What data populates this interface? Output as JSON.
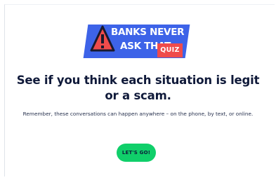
{
  "logo": {
    "line1": "BANKS NEVER",
    "line2": "ASK THAT",
    "tag": "QUIZ",
    "icon": "warning-triangle-icon",
    "colors": {
      "banner": "#3d63e8",
      "triangle": "#ef4b4b",
      "tag": "#ef4b4b"
    }
  },
  "main": {
    "headline": "See if you think each situation is legit or a scam.",
    "subtext": "Remember, these conversations can happen anywhere – on the phone, by text, or online.",
    "cta_label": "LET'S GO!"
  },
  "colors": {
    "cta": "#10cf6a",
    "headline": "#101a3a"
  }
}
